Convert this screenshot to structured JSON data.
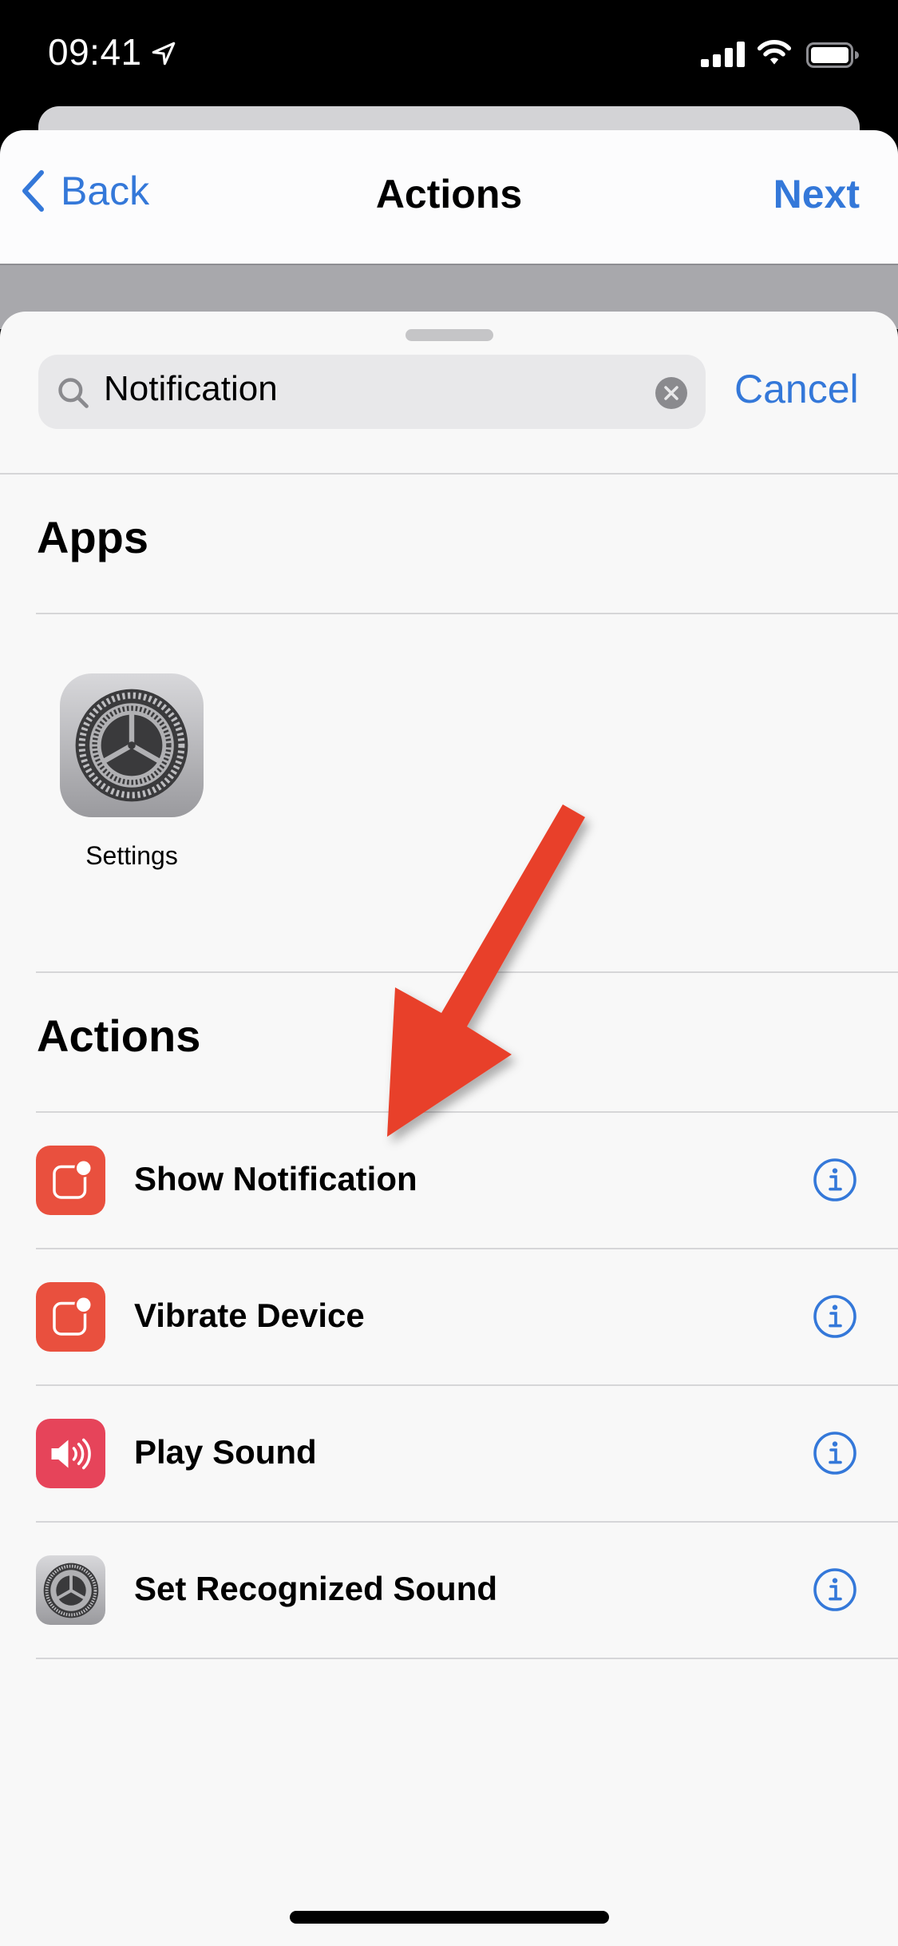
{
  "status_bar": {
    "time": "09:41",
    "icons": [
      "location-arrow-icon",
      "cellular-signal-icon",
      "wifi-icon",
      "battery-icon"
    ]
  },
  "nav": {
    "back_label": "Back",
    "title": "Actions",
    "next_label": "Next"
  },
  "search": {
    "value": "Notification",
    "placeholder": "Search",
    "cancel_label": "Cancel"
  },
  "apps_section": {
    "title": "Apps",
    "items": [
      {
        "label": "Settings",
        "icon": "settings-gear-icon"
      }
    ]
  },
  "actions_section": {
    "title": "Actions",
    "items": [
      {
        "label": "Show Notification",
        "icon": "notification-icon",
        "icon_color": "#e9503e"
      },
      {
        "label": "Vibrate Device",
        "icon": "notification-icon",
        "icon_color": "#e9503e"
      },
      {
        "label": "Play Sound",
        "icon": "speaker-icon",
        "icon_color": "#e6445a"
      },
      {
        "label": "Set Recognized Sound",
        "icon": "settings-gear-icon",
        "icon_color": "#9a9a9e"
      }
    ]
  },
  "colors": {
    "accent": "#3478d9",
    "annotation_arrow": "#e8402a"
  }
}
